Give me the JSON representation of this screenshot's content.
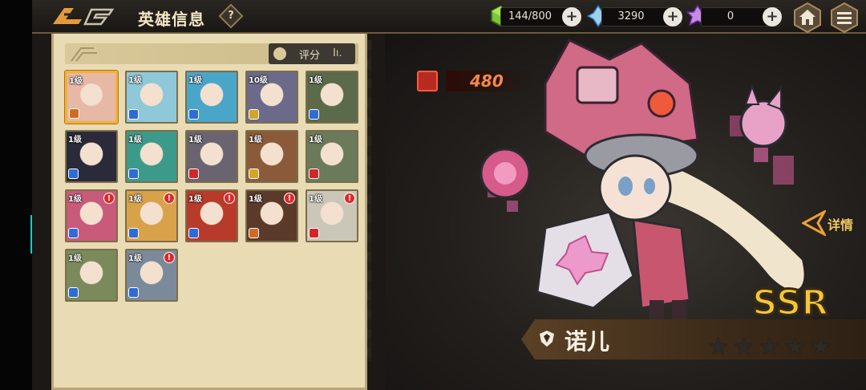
{
  "header": {
    "title": "英雄信息",
    "help": "?"
  },
  "resources": {
    "stamina": {
      "icon": "green-cube-icon",
      "value": "144/800"
    },
    "crystal": {
      "icon": "blue-crystal-icon",
      "value": "3290"
    },
    "pink_crystal": {
      "icon": "pink-crystal-icon",
      "value": "0"
    },
    "plus": "+"
  },
  "panel": {
    "sort_label": "评分",
    "sort_icon": "Iı.",
    "heroes": [
      {
        "level": "1级",
        "bg": "#e7b8a6",
        "badge": "#d26a26",
        "selected": true,
        "alert": false
      },
      {
        "level": "1级",
        "bg": "#8fc8d8",
        "badge": "#2f6bd3",
        "selected": false,
        "alert": false
      },
      {
        "level": "1级",
        "bg": "#4aa6c8",
        "badge": "#2f6bd3",
        "selected": false,
        "alert": false
      },
      {
        "level": "10级",
        "bg": "#6c6a8a",
        "badge": "#d2a526",
        "selected": false,
        "alert": false
      },
      {
        "level": "1级",
        "bg": "#5a6a4a",
        "badge": "#2f6bd3",
        "selected": false,
        "alert": false
      },
      {
        "level": "1级",
        "bg": "#2a2a3a",
        "badge": "#2f6bd3",
        "selected": false,
        "alert": false
      },
      {
        "level": "1级",
        "bg": "#3c9a8a",
        "badge": "#2f6bd3",
        "selected": false,
        "alert": false
      },
      {
        "level": "1级",
        "bg": "#6a6470",
        "badge": "#d2262a",
        "selected": false,
        "alert": false
      },
      {
        "level": "1级",
        "bg": "#8a5a3a",
        "badge": "#d2a526",
        "selected": false,
        "alert": false
      },
      {
        "level": "1级",
        "bg": "#6a7a5a",
        "badge": "#d2262a",
        "selected": false,
        "alert": false
      },
      {
        "level": "1级",
        "bg": "#c85a7a",
        "badge": "#2f6bd3",
        "selected": false,
        "alert": true
      },
      {
        "level": "1级",
        "bg": "#d8a24a",
        "badge": "#2f6bd3",
        "selected": false,
        "alert": true
      },
      {
        "level": "1级",
        "bg": "#b83a2a",
        "badge": "#2f6bd3",
        "selected": false,
        "alert": true
      },
      {
        "level": "1级",
        "bg": "#5a3a2a",
        "badge": "#d26a26",
        "selected": false,
        "alert": true
      },
      {
        "level": "1级",
        "bg": "#cac6b8",
        "badge": "#d2262a",
        "selected": false,
        "alert": true
      },
      {
        "level": "1级",
        "bg": "#7a8a5a",
        "badge": "#2f6bd3",
        "selected": false,
        "alert": false
      },
      {
        "level": "1级",
        "bg": "#7a8a9a",
        "badge": "#2f6bd3",
        "selected": false,
        "alert": true
      }
    ],
    "alert_mark": "!"
  },
  "hero_detail": {
    "power": "480",
    "name": "诺儿",
    "rarity": "SSR",
    "detail_label": "详情",
    "stars": [
      "★",
      "★",
      "★",
      "★",
      "★"
    ]
  },
  "colors": {
    "panel_bg": "#e9dcb5",
    "selected_border": "#f1b236",
    "accent_gold": "#f0c860",
    "power_orange": "#f5874a"
  }
}
